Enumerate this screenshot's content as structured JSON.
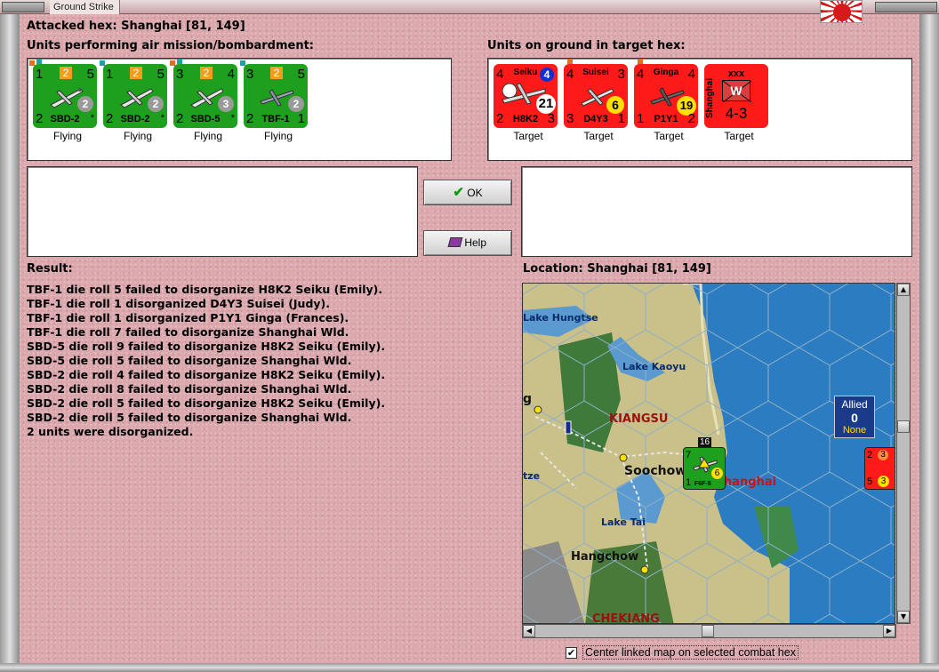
{
  "window": {
    "title": "Ground Strike"
  },
  "attacked_hex": "Attacked hex: Shanghai  [81, 149]",
  "air_units_header": "Units performing air mission/bombardment:",
  "ground_units_header": "Units on ground in target hex:",
  "air_units": [
    {
      "tl": "1",
      "orange": "2",
      "tr": "5",
      "bl": "2",
      "type": "SBD-2",
      "br": "*",
      "disc": "2",
      "status": "Flying"
    },
    {
      "tl": "1",
      "orange": "2",
      "tr": "5",
      "bl": "2",
      "type": "SBD-2",
      "br": "*",
      "disc": "2",
      "status": "Flying"
    },
    {
      "tl": "3",
      "orange": "2",
      "tr": "4",
      "bl": "2",
      "type": "SBD-5",
      "br": "*",
      "disc": "3",
      "status": "Flying"
    },
    {
      "tl": "3",
      "orange": "2",
      "tr": "5",
      "bl": "2",
      "type": "TBF-1",
      "br": "1",
      "disc": "2",
      "status": "Flying"
    }
  ],
  "ground_units": [
    {
      "tl": "4",
      "name": "Seiku",
      "tr": "4",
      "bl": "2",
      "type": "H8K2",
      "br": "3",
      "disc": "21",
      "status": "Target"
    },
    {
      "tl": "4",
      "name": "Suisei",
      "tr": "3",
      "bl": "3",
      "type": "D4Y3",
      "br": "1",
      "disc": "6",
      "status": "Target"
    },
    {
      "tl": "4",
      "name": "Ginga",
      "tr": "4",
      "bl": "1",
      "type": "P1Y1",
      "br": "2",
      "disc": "19",
      "status": "Target"
    },
    {
      "top": "xxx",
      "side": "Shanghai",
      "symbol": "W",
      "value": "4-3",
      "status": "Target"
    }
  ],
  "buttons": {
    "ok": "OK",
    "help": "Help"
  },
  "result_label": "Result:",
  "location_label": "Location:  Shanghai  [81, 149]",
  "result_lines": [
    "TBF-1 die roll 5 failed to disorganize H8K2 Seiku (Emily).",
    "TBF-1 die roll 1 disorganized D4Y3 Suisei (Judy).",
    "TBF-1 die roll 1 disorganized P1Y1 Ginga (Frances).",
    "TBF-1 die roll 7 failed to disorganize Shanghai Wld.",
    "SBD-5 die roll 9 failed to disorganize H8K2 Seiku (Emily).",
    "SBD-5 die roll 5 failed to disorganize Shanghai Wld.",
    "SBD-2 die roll 4 failed to disorganize H8K2 Seiku (Emily).",
    "SBD-2 die roll 8 failed to disorganize Shanghai Wld.",
    "SBD-2 die roll 5 failed to disorganize H8K2 Seiku (Emily).",
    "SBD-2 die roll 5 failed to disorganize Shanghai Wld.",
    "2 units were disorganized."
  ],
  "map": {
    "labels": {
      "hungtse": "Lake Hungtse",
      "kaoyu": "Lake Kaoyu",
      "kiangsu": "KIANGSU",
      "soochow": "Soochow",
      "shanghai": "hanghai",
      "tai": "Lake Tai",
      "hangchow": "Hangchow",
      "chekiang": "CHEKIANG",
      "tze": "tze",
      "g": "g"
    },
    "allied_box": {
      "title": "Allied",
      "count": "0",
      "status": "None"
    },
    "fighter": {
      "stack": "16",
      "tl": "7",
      "type": "F6F-5",
      "bl": "1",
      "disc": "6"
    },
    "red_unit": {
      "tl": "2",
      "disc1": "3",
      "bl": "5",
      "disc2": "3"
    }
  },
  "center_map": {
    "label": "Center linked map on selected combat hex",
    "checked": true
  }
}
